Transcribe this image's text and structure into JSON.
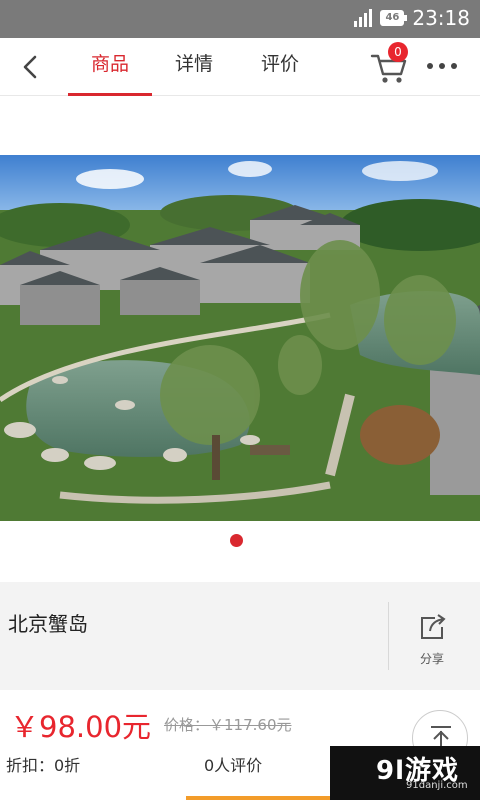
{
  "status_bar": {
    "network": "46",
    "time": "23:18"
  },
  "nav": {
    "tabs": [
      {
        "label": "商品",
        "active": true
      },
      {
        "label": "详情",
        "active": false
      },
      {
        "label": "评价",
        "active": false
      }
    ],
    "cart_count": "0",
    "icons": {
      "back": "chevron-left-icon",
      "cart": "cart-icon",
      "more": "more-dots-icon"
    }
  },
  "gallery": {
    "image_subject": "garden-courtyard-photo",
    "pages": 1,
    "current_page": 1
  },
  "product": {
    "name": "北京蟹岛",
    "share_label": "分享",
    "price": "￥98.00元",
    "original_price": "价格：￥117.60元",
    "discount": "折扣：0折",
    "reviews": "0人评价"
  },
  "watermark": {
    "main": "9l游戏",
    "sub": "91danji.com"
  },
  "colors": {
    "accent": "#d9282f",
    "price": "#e8262e",
    "status_bar": "#7a7a7a"
  }
}
